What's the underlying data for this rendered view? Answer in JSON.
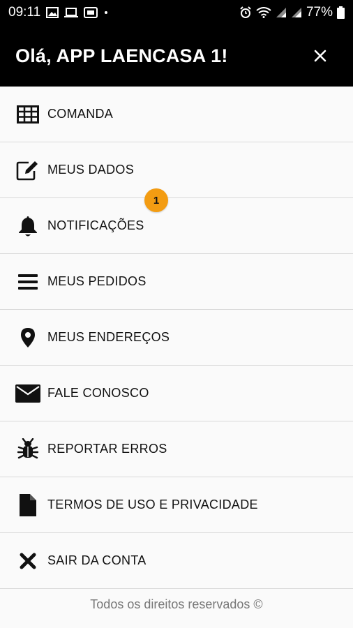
{
  "status_bar": {
    "time": "09:11",
    "battery": "77%",
    "icons": [
      "image-icon",
      "laptop-icon",
      "media-icon",
      "dot-icon",
      "alarm-icon",
      "wifi-icon",
      "signal-icon",
      "signal-icon",
      "battery-icon"
    ]
  },
  "header": {
    "title": "Olá, APP LAENCASA 1!",
    "close_icon": "close-icon"
  },
  "menu": {
    "items": [
      {
        "label": "COMANDA",
        "icon": "table-grid-icon"
      },
      {
        "label": "MEUS DADOS",
        "icon": "edit-icon"
      },
      {
        "label": "NOTIFICAÇÕES",
        "icon": "bell-icon"
      },
      {
        "label": "MEUS PEDIDOS",
        "icon": "list-icon"
      },
      {
        "label": "MEUS ENDEREÇOS",
        "icon": "map-pin-icon"
      },
      {
        "label": "FALE CONOSCO",
        "icon": "envelope-icon"
      },
      {
        "label": "REPORTAR ERROS",
        "icon": "bug-icon"
      },
      {
        "label": "TERMOS DE USO E PRIVACIDADE",
        "icon": "document-icon"
      },
      {
        "label": "SAIR DA CONTA",
        "icon": "x-icon"
      }
    ],
    "notification_badge": "1"
  },
  "footer": {
    "text": "Todos os direitos reservados ©"
  },
  "colors": {
    "header_bg": "#000000",
    "badge": "#f39c12",
    "background": "#fafafa"
  }
}
